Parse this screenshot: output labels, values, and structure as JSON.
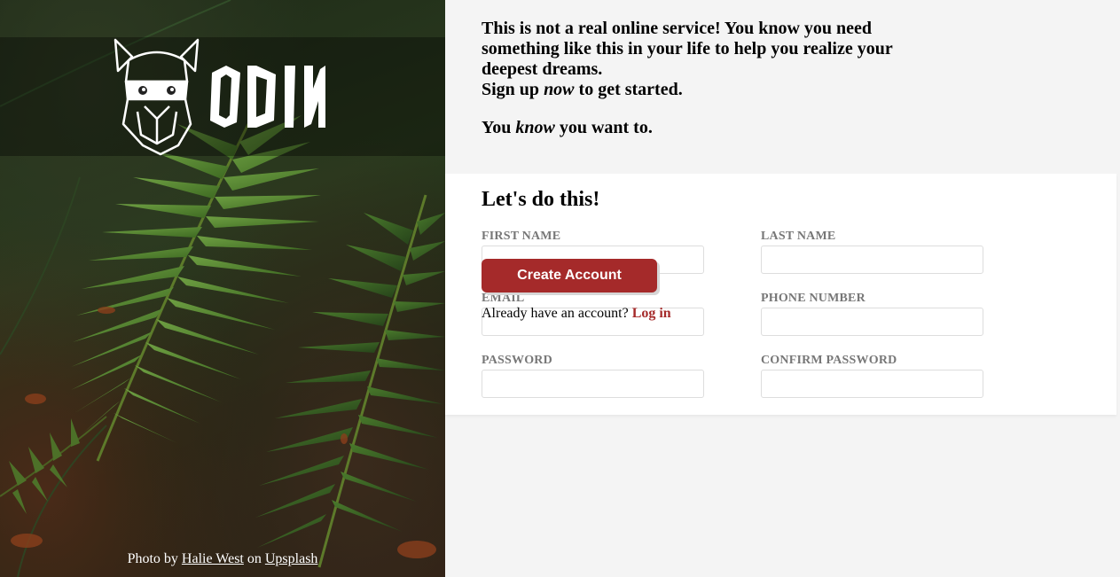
{
  "brand": {
    "name": "ODIN",
    "logo_icon": "viking-helmet-icon"
  },
  "credit": {
    "prefix": "Photo by",
    "author": "Halie West",
    "middle": "on",
    "source": "Upsplash"
  },
  "intro": {
    "line1": "This is not a real online service! You know you need something like this in your life to help you realize your deepest dreams.",
    "signup_prefix": "Sign up",
    "signup_em": "now",
    "signup_suffix": "to get started.",
    "know_prefix": "You",
    "know_em": "know",
    "know_suffix": "you want to."
  },
  "form": {
    "title": "Let's do this!",
    "fields": {
      "first_name": {
        "label": "FIRST NAME",
        "value": ""
      },
      "last_name": {
        "label": "LAST NAME",
        "value": ""
      },
      "email": {
        "label": "EMAIL",
        "value": ""
      },
      "phone": {
        "label": "PHONE NUMBER",
        "value": ""
      },
      "password": {
        "label": "PASSWORD",
        "value": ""
      },
      "confirm_password": {
        "label": "CONFIRM PASSWORD",
        "value": ""
      }
    },
    "submit_label": "Create Account"
  },
  "login": {
    "prompt": "Already have an account?",
    "link_label": "Log in"
  },
  "colors": {
    "accent": "#a52a2a",
    "panel": "#ffffff",
    "background": "#f4f4f4",
    "label": "#777777"
  }
}
